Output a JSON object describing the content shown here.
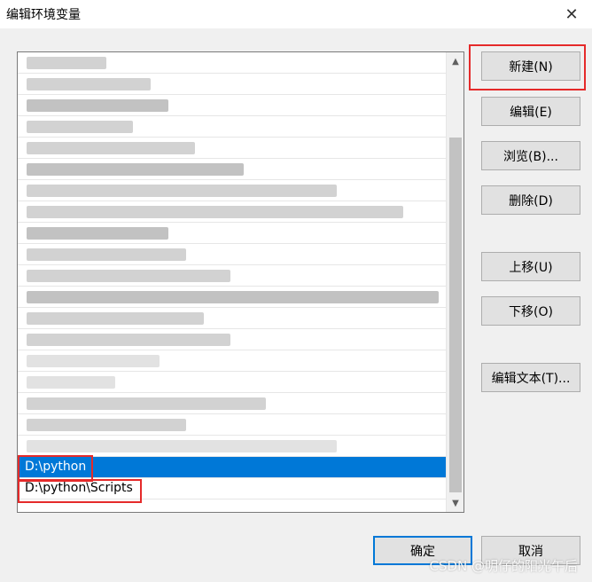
{
  "window": {
    "title": "编辑环境变量",
    "close_glyph": "✕"
  },
  "list": {
    "visible_rows": [
      {
        "text": "D:\\python",
        "selected": true
      },
      {
        "text": "D:\\python\\Scripts",
        "selected": false
      }
    ]
  },
  "buttons": {
    "new": "新建(N)",
    "edit": "编辑(E)",
    "browse": "浏览(B)...",
    "delete": "删除(D)",
    "move_up": "上移(U)",
    "move_down": "下移(O)",
    "edit_text": "编辑文本(T)...",
    "ok": "确定",
    "cancel": "取消"
  },
  "watermark": "CSDN @明仔的阳光午后",
  "colors": {
    "selection": "#0078d7",
    "highlight_box": "#e52a2a"
  },
  "icons": {
    "close": "close-icon",
    "scroll_up": "scroll-up-arrow-icon",
    "scroll_down": "scroll-down-arrow-icon"
  }
}
